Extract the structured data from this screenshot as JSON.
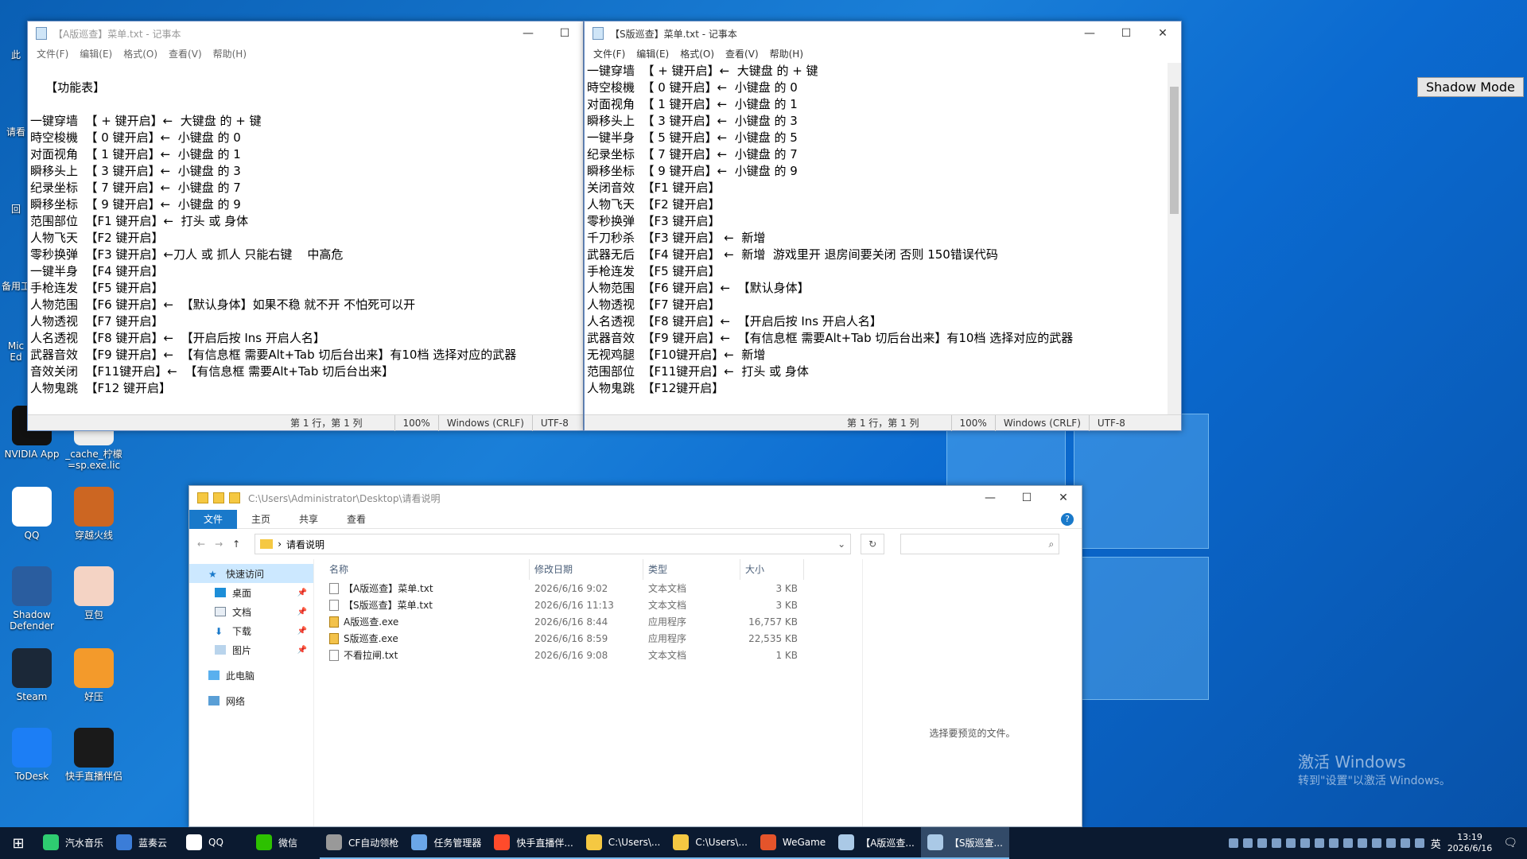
{
  "notepad_a": {
    "title": "【A版巡查】菜单.txt - 记事本",
    "menu": [
      "文件(F)",
      "编辑(E)",
      "格式(O)",
      "查看(V)",
      "帮助(H)"
    ],
    "content": "\n    【功能表】\n\n一键穿墙  【 + 键开启】←  大键盘 的 + 键\n時空梭機  【 0 键开启】←  小键盘 的 0\n对面视角  【 1 键开启】←  小键盘 的 1\n瞬移头上  【 3 键开启】←  小键盘 的 3\n纪录坐标  【 7 键开启】←  小键盘 的 7\n瞬移坐标  【 9 键开启】←  小键盘 的 9\n范围部位  【F1 键开启】←  打头 或 身体\n人物飞天  【F2 键开启】\n零秒换弹  【F3 键开启】←刀人 或 抓人 只能右键    中高危\n一键半身  【F4 键开启】\n手枪连发  【F5 键开启】\n人物范围  【F6 键开启】←  【默认身体】如果不稳 就不开 不怕死可以开\n人物透视  【F7 键开启】\n人名透视  【F8 键开启】←  【开启后按 Ins 开启人名】\n武器音效  【F9 键开启】←  【有信息框 需要Alt+Tab 切后台出来】有10档 选择对应的武器\n音效关闭  【F11键开启】←  【有信息框 需要Alt+Tab 切后台出来】\n人物鬼跳  【F12 键开启】",
    "status": {
      "position": "第 1 行，第 1 列",
      "zoom": "100%",
      "eol": "Windows (CRLF)",
      "encoding": "UTF-8"
    }
  },
  "notepad_s": {
    "title": "【S版巡查】菜单.txt - 记事本",
    "menu": [
      "文件(F)",
      "编辑(E)",
      "格式(O)",
      "查看(V)",
      "帮助(H)"
    ],
    "content": "一键穿墙  【 + 键开启】←  大键盘 的 + 键\n時空梭機  【 0 键开启】←  小键盘 的 0\n对面视角  【 1 键开启】←  小键盘 的 1\n瞬移头上  【 3 键开启】←  小键盘 的 3\n一键半身  【 5 键开启】←  小键盘 的 5\n纪录坐标  【 7 键开启】←  小键盘 的 7\n瞬移坐标  【 9 键开启】←  小键盘 的 9\n关闭音效  【F1 键开启】\n人物飞天  【F2 键开启】\n零秒换弹  【F3 键开启】\n千刀秒杀  【F3 键开启】 ←  新增\n武器无后  【F4 键开启】 ←  新增  游戏里开 退房间要关闭 否则 150错误代码\n手枪连发  【F5 键开启】\n人物范围  【F6 键开启】←  【默认身体】\n人物透视  【F7 键开启】\n人名透视  【F8 键开启】←  【开启后按 Ins 开启人名】\n武器音效  【F9 键开启】←  【有信息框 需要Alt+Tab 切后台出来】有10档 选择对应的武器\n无视鸡腿  【F10键开启】←  新增\n范围部位  【F11键开启】←  打头 或 身体\n人物鬼跳  【F12键开启】",
    "status": {
      "position": "第 1 行，第 1 列",
      "zoom": "100%",
      "eol": "Windows (CRLF)",
      "encoding": "UTF-8"
    }
  },
  "explorer": {
    "title_path": "C:\\Users\\Administrator\\Desktop\\请看说明",
    "ribbon": {
      "file": "文件",
      "home": "主页",
      "share": "共享",
      "view": "查看",
      "help": "?"
    },
    "address": "请看说明",
    "nav": {
      "quick_access": "快速访问",
      "desktop": "桌面",
      "documents": "文档",
      "downloads": "下载",
      "pictures": "图片",
      "this_pc": "此电脑",
      "network": "网络"
    },
    "columns": {
      "name": "名称",
      "date": "修改日期",
      "type": "类型",
      "size": "大小"
    },
    "files": [
      {
        "name": "【A版巡查】菜单.txt",
        "date": "2026/6/16 9:02",
        "type": "文本文档",
        "size": "3 KB",
        "kind": "txt"
      },
      {
        "name": "【S版巡查】菜单.txt",
        "date": "2026/6/16 11:13",
        "type": "文本文档",
        "size": "3 KB",
        "kind": "txt"
      },
      {
        "name": "A版巡查.exe",
        "date": "2026/6/16 8:44",
        "type": "应用程序",
        "size": "16,757 KB",
        "kind": "exe"
      },
      {
        "name": "S版巡查.exe",
        "date": "2026/6/16 8:59",
        "type": "应用程序",
        "size": "22,535 KB",
        "kind": "exe"
      },
      {
        "name": "不看拉闸.txt",
        "date": "2026/6/16 9:08",
        "type": "文本文档",
        "size": "1 KB",
        "kind": "txt"
      }
    ],
    "preview_text": "选择要预览的文件。"
  },
  "desktop": {
    "icons": [
      {
        "label": "NVIDIA App",
        "color": "#111"
      },
      {
        "label": "_cache_柠檬\n=sp.exe.lic",
        "color": "#eee"
      },
      {
        "label": "QQ",
        "color": "#fff"
      },
      {
        "label": "穿越火线",
        "color": "#c62"
      },
      {
        "label": "Shadow\nDefender",
        "color": "#2a5d9f"
      },
      {
        "label": "豆包",
        "color": "#f4d3c4"
      },
      {
        "label": "Steam",
        "color": "#1b2838"
      },
      {
        "label": "好压",
        "color": "#f39a2b"
      },
      {
        "label": "ToDesk",
        "color": "#1c7ef5"
      },
      {
        "label": "快手直播伴侣",
        "color": "#1a1a1a"
      }
    ],
    "left_edge_labels": [
      "此",
      "请看",
      "回",
      "备用工",
      "Mic\nEd"
    ],
    "shadow_mode": "Shadow Mode",
    "activate_title": "激活 Windows",
    "activate_sub": "转到\"设置\"以激活 Windows。"
  },
  "taskbar": {
    "items": [
      {
        "label": "汽水音乐",
        "color": "#2ecc71"
      },
      {
        "label": "蓝奏云",
        "color": "#3b7dd8"
      },
      {
        "label": "QQ",
        "color": "#fff"
      },
      {
        "label": "微信",
        "color": "#2dc100"
      },
      {
        "label": "CF自动领枪",
        "color": "#999"
      },
      {
        "label": "任务管理器",
        "color": "#6aa6e8"
      },
      {
        "label": "快手直播伴...",
        "color": "#ff4b2b"
      },
      {
        "label": "C:\\Users\\...",
        "color": "#f5c842"
      },
      {
        "label": "C:\\Users\\...",
        "color": "#f5c842"
      },
      {
        "label": "WeGame",
        "color": "#e4542b"
      },
      {
        "label": "【A版巡查...",
        "color": "#aac9e6"
      },
      {
        "label": "【S版巡查...",
        "color": "#aac9e6"
      }
    ],
    "time": "13:19",
    "date": "2026/6/16",
    "ime": "英"
  }
}
